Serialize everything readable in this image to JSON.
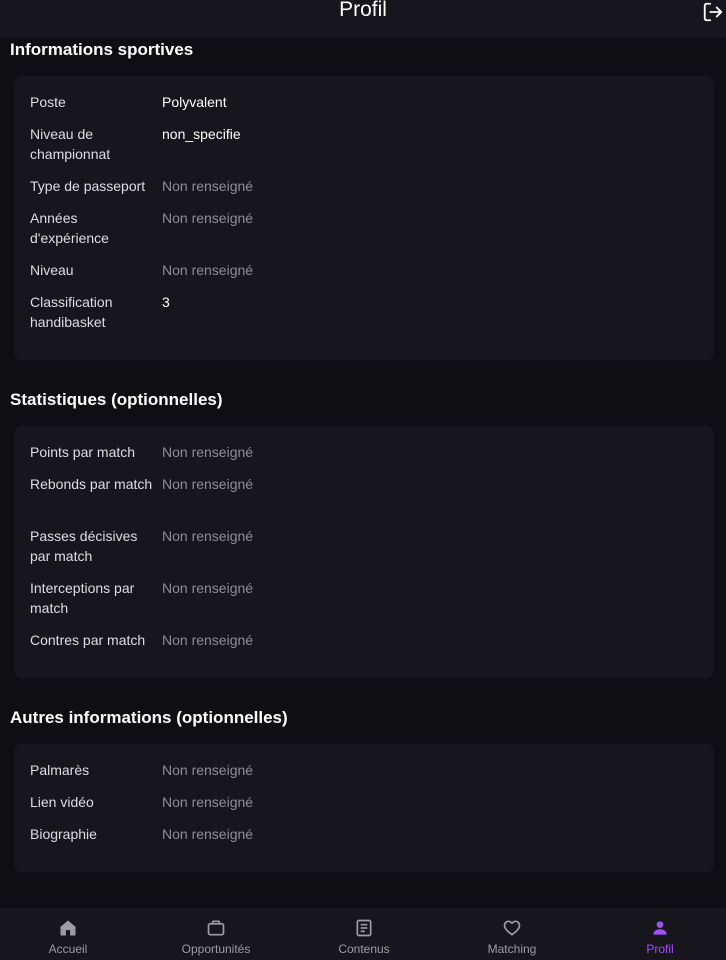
{
  "header": {
    "title": "Profil",
    "logout_icon": "logout-icon"
  },
  "sections": {
    "sport": {
      "title": "Informations sportives",
      "rows": [
        {
          "label": "Poste",
          "value": "Polyvalent"
        },
        {
          "label": "Niveau de championnat",
          "value": "non_specifie"
        },
        {
          "label": "Type de passeport",
          "value": "Non renseigné"
        },
        {
          "label": "Années d'expérience",
          "value": "Non renseigné"
        },
        {
          "label": "Niveau",
          "value": "Non renseigné"
        },
        {
          "label": "Classification handibasket",
          "value": "3"
        }
      ]
    },
    "stats": {
      "title": "Statistiques (optionnelles)",
      "rows": [
        {
          "label": "Points par match",
          "value": "Non renseigné"
        },
        {
          "label": "Rebonds par match",
          "value": "Non renseigné"
        },
        {
          "label": "Passes décisives par match",
          "value": "Non renseigné"
        },
        {
          "label": "Interceptions par match",
          "value": "Non renseigné"
        },
        {
          "label": "Contres par match",
          "value": "Non renseigné"
        }
      ]
    },
    "other": {
      "title": "Autres informations (optionnelles)",
      "rows": [
        {
          "label": "Palmarès",
          "value": "Non renseigné"
        },
        {
          "label": "Lien vidéo",
          "value": "Non renseigné"
        },
        {
          "label": "Biographie",
          "value": "Non renseigné"
        }
      ]
    }
  },
  "tabbar": {
    "tabs": [
      {
        "label": "Accueil",
        "icon": "home-icon"
      },
      {
        "label": "Opportunités",
        "icon": "briefcase-icon"
      },
      {
        "label": "Contenus",
        "icon": "article-icon"
      },
      {
        "label": "Matching",
        "icon": "heart-icon"
      },
      {
        "label": "Profil",
        "icon": "person-icon"
      }
    ],
    "active": "Profil"
  },
  "colors": {
    "background": "#0f0e13",
    "card": "#17161d",
    "accent": "#a64dff",
    "muted_text": "#8e8d95"
  }
}
